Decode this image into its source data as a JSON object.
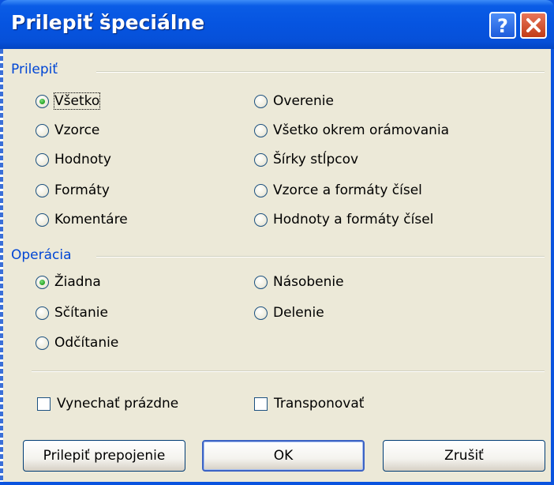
{
  "dialog": {
    "title": "Prilepiť špeciálne",
    "help_glyph": "?",
    "close_glyph": "✕"
  },
  "paste_group": {
    "label": "Prilepiť",
    "left_options": [
      "Všetko",
      "Vzorce",
      "Hodnoty",
      "Formáty",
      "Komentáre"
    ],
    "right_options": [
      "Overenie",
      "Všetko okrem orámovania",
      "Šírky stĺpcov",
      "Vzorce a formáty čísel",
      "Hodnoty a formáty čísel"
    ],
    "selected": "Všetko"
  },
  "operation_group": {
    "label": "Operácia",
    "left_options": [
      "Žiadna",
      "Sčítanie",
      "Odčítanie"
    ],
    "right_options": [
      "Násobenie",
      "Delenie"
    ],
    "selected": "Žiadna"
  },
  "checkboxes": {
    "skip_blanks": "Vynechať prázdne",
    "transpose": "Transponovať"
  },
  "buttons": {
    "paste_link": "Prilepiť prepojenie",
    "ok": "OK",
    "cancel": "Zrušiť"
  }
}
